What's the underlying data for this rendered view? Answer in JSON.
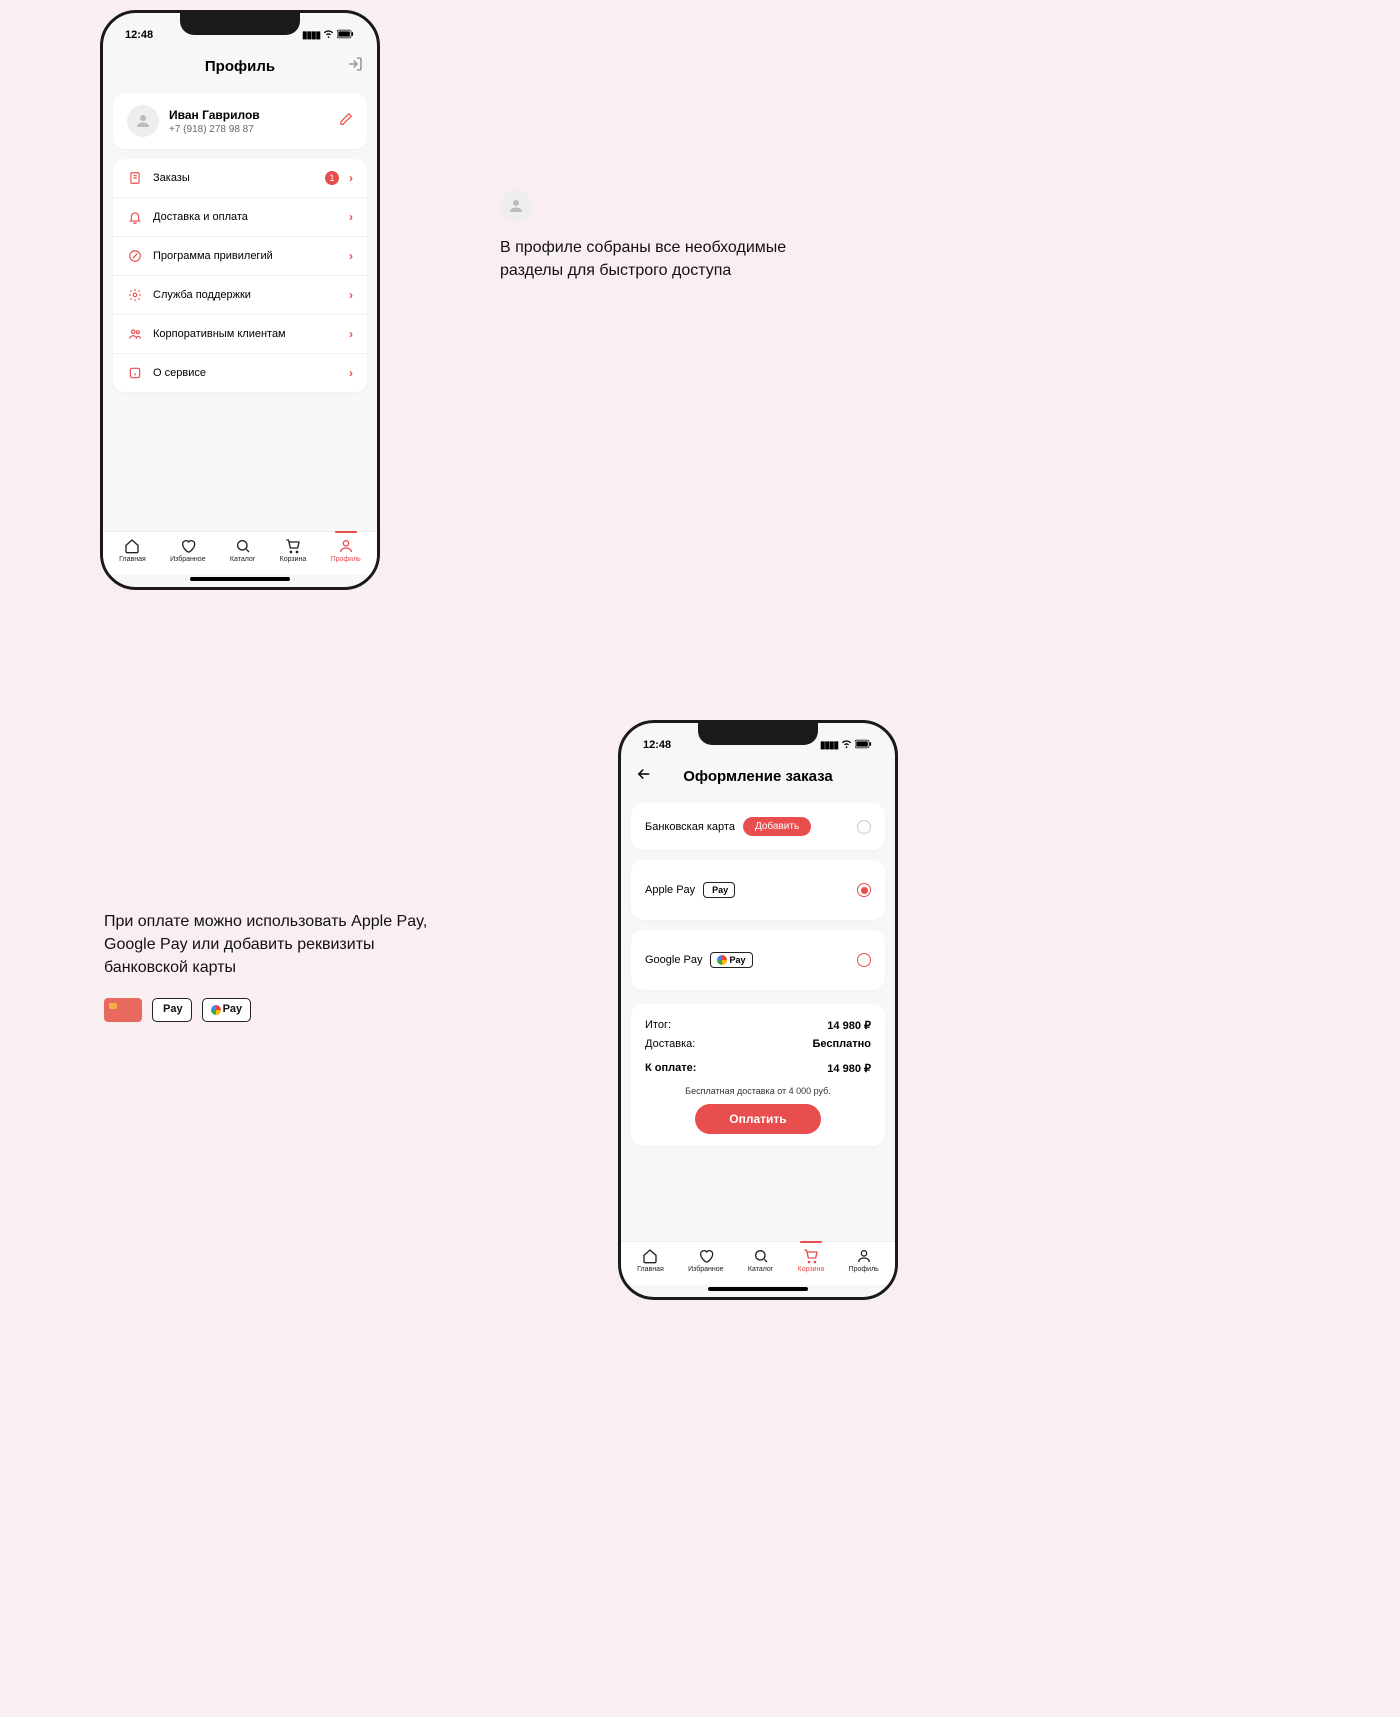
{
  "status_time": "12:48",
  "profile": {
    "title": "Профиль",
    "user_name": "Иван Гаврилов",
    "user_phone": "+7 (918) 278 98 87",
    "menu": [
      {
        "label": "Заказы",
        "badge": "1"
      },
      {
        "label": "Доставка и оплата"
      },
      {
        "label": "Программа привилегий"
      },
      {
        "label": "Служба поддержки"
      },
      {
        "label": "Корпоративным клиентам"
      },
      {
        "label": "О сервисе"
      }
    ]
  },
  "tabs": {
    "home": "Главная",
    "fav": "Избранное",
    "catalog": "Каталог",
    "cart": "Корзина",
    "profile": "Профиль"
  },
  "checkout": {
    "title": "Оформление заказа",
    "bank_card": "Банковская карта",
    "add": "Добавить",
    "apple_pay": "Apple Pay",
    "google_pay": "Google Pay",
    "apple_logo": "Pay",
    "google_logo": "Pay",
    "summary": {
      "total_label": "Итог:",
      "total_value": "14 980 ₽",
      "delivery_label": "Доставка:",
      "delivery_value": "Бесплатно",
      "pay_label": "К оплате:",
      "pay_value": "14 980 ₽"
    },
    "free_note": "Бесплатная доставка от 4 000 руб.",
    "pay_button": "Оплатить"
  },
  "annotations": {
    "a1": "В профиле собраны все необходимые разделы для быстрого доступа",
    "a2": "При оплате можно использовать Apple Pay, Google Pay или добавить реквизиты банковской карты"
  }
}
